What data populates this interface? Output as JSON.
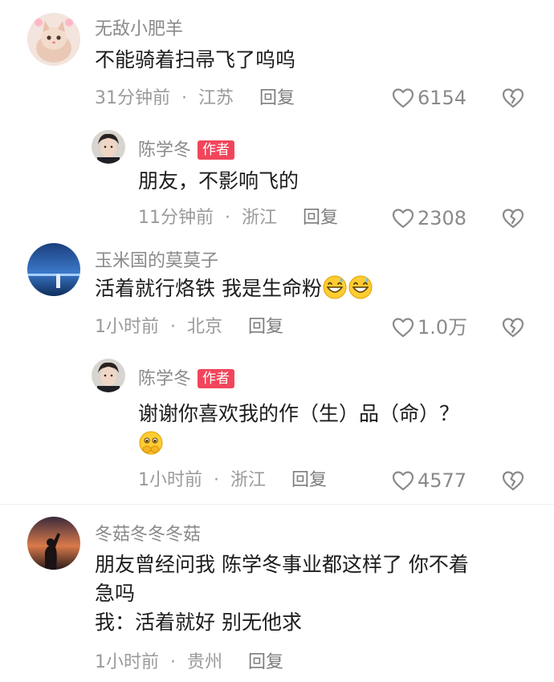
{
  "comments": [
    {
      "username": "无敌小肥羊",
      "content": "不能骑着扫帚飞了呜呜",
      "time": "31分钟前",
      "location": "江苏",
      "reply_label": "回复",
      "likes": "6154"
    },
    {
      "username": "陈学冬",
      "badge": "作者",
      "content": "朋友，不影响飞的",
      "time": "11分钟前",
      "location": "浙江",
      "reply_label": "回复",
      "likes": "2308"
    },
    {
      "username": "玉米国的莫莫子",
      "content": "活着就行烙铁 我是生命粉",
      "time": "1小时前",
      "location": "北京",
      "reply_label": "回复",
      "likes": "1.0万"
    },
    {
      "username": "陈学冬",
      "badge": "作者",
      "content": "谢谢你喜欢我的作（生）品（命）？",
      "time": "1小时前",
      "location": "浙江",
      "reply_label": "回复",
      "likes": "4577"
    },
    {
      "username": "冬菇冬冬冬菇",
      "content_line1": "朋友曾经问我 陈学冬事业都这样了 你不着",
      "content_line2": "急吗",
      "content_line3": "我：活着就好 别无他求",
      "time": "1小时前",
      "location": "贵州",
      "reply_label": "回复"
    }
  ],
  "colors": {
    "badge": "#f2455b",
    "meta": "#9a9a9a",
    "username": "#8a8a8a"
  },
  "icons": {
    "like": "heart-outline-icon",
    "dislike": "broken-heart-outline-icon",
    "emoji_laugh": "grinning-sweat-emoji",
    "emoji_shy": "pleading-face-emoji"
  }
}
